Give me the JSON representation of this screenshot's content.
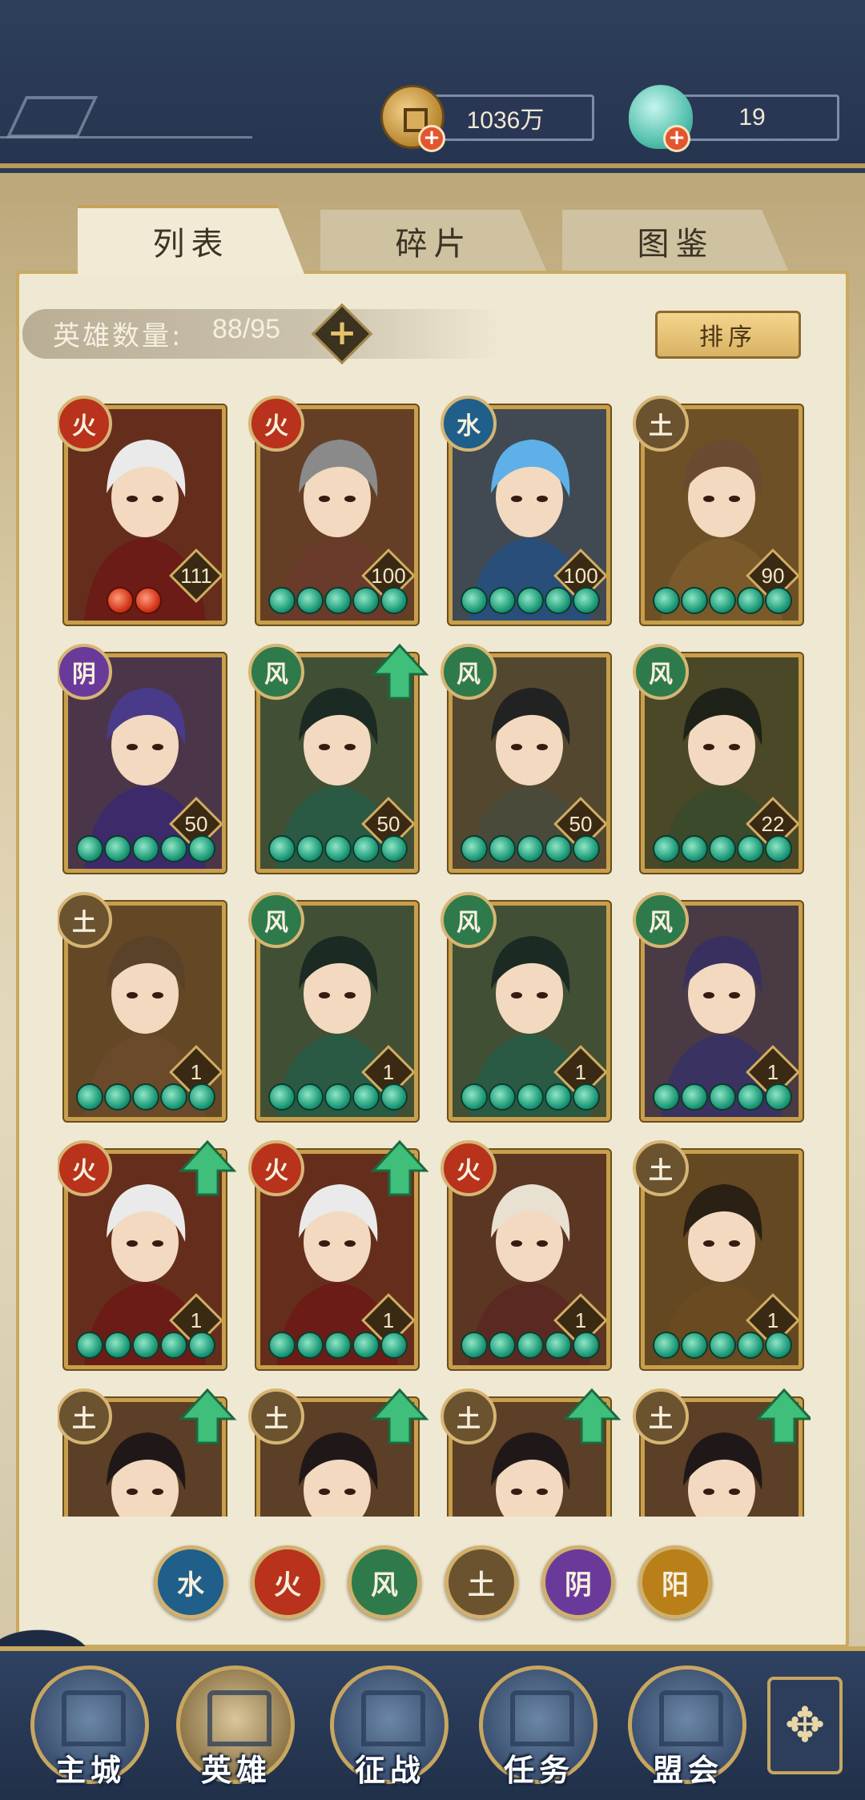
{
  "resources": {
    "coin_amount": "1036万",
    "gem_amount": "19",
    "coin_icon": "copper-coin-icon",
    "gem_icon": "jade-icon"
  },
  "tabs": [
    {
      "label": "列表",
      "active": true
    },
    {
      "label": "碎片",
      "active": false
    },
    {
      "label": "图鉴",
      "active": false
    }
  ],
  "hero_count": {
    "label": "英雄数量:",
    "value": "88/95"
  },
  "sort_button": "排序",
  "element_colors": {
    "火": "#b8321c",
    "水": "#1f5f8a",
    "风": "#2f7a4a",
    "土": "#6b5330",
    "阴": "#6a3a9a",
    "阳": "#b9801a"
  },
  "heroes": [
    {
      "element": "火",
      "level": "111",
      "stars": 2,
      "star_color": "red",
      "upgrade": false,
      "tint": "#6b1c17",
      "hair": "#eaeaea"
    },
    {
      "element": "火",
      "level": "100",
      "stars": 5,
      "star_color": "green",
      "upgrade": false,
      "tint": "#6a3a2a",
      "hair": "#8a8a8a"
    },
    {
      "element": "水",
      "level": "100",
      "stars": 5,
      "star_color": "green",
      "upgrade": false,
      "tint": "#2a4e7a",
      "hair": "#5fb0e8"
    },
    {
      "element": "土",
      "level": "90",
      "stars": 5,
      "star_color": "green",
      "upgrade": false,
      "tint": "#7a5a2a",
      "hair": "#6a4a30"
    },
    {
      "element": "阴",
      "level": "50",
      "stars": 5,
      "star_color": "green",
      "upgrade": false,
      "tint": "#3c2a6a",
      "hair": "#4a3a8a"
    },
    {
      "element": "风",
      "level": "50",
      "stars": 5,
      "star_color": "green",
      "upgrade": true,
      "tint": "#2a5a44",
      "hair": "#1c2a24"
    },
    {
      "element": "风",
      "level": "50",
      "stars": 5,
      "star_color": "green",
      "upgrade": false,
      "tint": "#4a4a3a",
      "hair": "#222222"
    },
    {
      "element": "风",
      "level": "22",
      "stars": 5,
      "star_color": "green",
      "upgrade": false,
      "tint": "#3a4a2a",
      "hair": "#1e2218"
    },
    {
      "element": "土",
      "level": "1",
      "stars": 5,
      "star_color": "green",
      "upgrade": false,
      "tint": "#6a4a2a",
      "hair": "#5a4228"
    },
    {
      "element": "风",
      "level": "1",
      "stars": 5,
      "star_color": "green",
      "upgrade": false,
      "tint": "#2a5a44",
      "hair": "#1c2a24"
    },
    {
      "element": "风",
      "level": "1",
      "stars": 5,
      "star_color": "green",
      "upgrade": false,
      "tint": "#2a5a44",
      "hair": "#1c2a24"
    },
    {
      "element": "风",
      "level": "1",
      "stars": 5,
      "star_color": "green",
      "upgrade": false,
      "tint": "#3a3260",
      "hair": "#3a3060"
    },
    {
      "element": "火",
      "level": "1",
      "stars": 5,
      "star_color": "green",
      "upgrade": true,
      "tint": "#6b1c17",
      "hair": "#eaeaea"
    },
    {
      "element": "火",
      "level": "1",
      "stars": 5,
      "star_color": "green",
      "upgrade": true,
      "tint": "#6b1c17",
      "hair": "#eaeaea"
    },
    {
      "element": "火",
      "level": "1",
      "stars": 5,
      "star_color": "green",
      "upgrade": false,
      "tint": "#5a2a22",
      "hair": "#e8e0d0"
    },
    {
      "element": "土",
      "level": "1",
      "stars": 5,
      "star_color": "green",
      "upgrade": false,
      "tint": "#6a4a20",
      "hair": "#2a2014"
    },
    {
      "element": "土",
      "level": "",
      "stars": 0,
      "star_color": "green",
      "upgrade": true,
      "tint": "#5a3a2a",
      "hair": "#201818"
    },
    {
      "element": "土",
      "level": "",
      "stars": 0,
      "star_color": "green",
      "upgrade": true,
      "tint": "#5a3a2a",
      "hair": "#201818"
    },
    {
      "element": "土",
      "level": "",
      "stars": 0,
      "star_color": "green",
      "upgrade": true,
      "tint": "#5a3a2a",
      "hair": "#201818"
    },
    {
      "element": "土",
      "level": "",
      "stars": 0,
      "star_color": "green",
      "upgrade": true,
      "tint": "#5a3a2a",
      "hair": "#201818"
    }
  ],
  "element_filters": [
    "水",
    "火",
    "风",
    "土",
    "阴",
    "阳"
  ],
  "bottom_nav": [
    {
      "label": "主城",
      "icon": "city-gate-icon",
      "active": false
    },
    {
      "label": "英雄",
      "icon": "hero-portrait-icon",
      "active": true
    },
    {
      "label": "征战",
      "icon": "battle-icon",
      "active": false
    },
    {
      "label": "任务",
      "icon": "scroll-icon",
      "active": false
    },
    {
      "label": "盟会",
      "icon": "alliance-icon",
      "active": false
    }
  ],
  "more_icon": "lattice-menu-icon"
}
